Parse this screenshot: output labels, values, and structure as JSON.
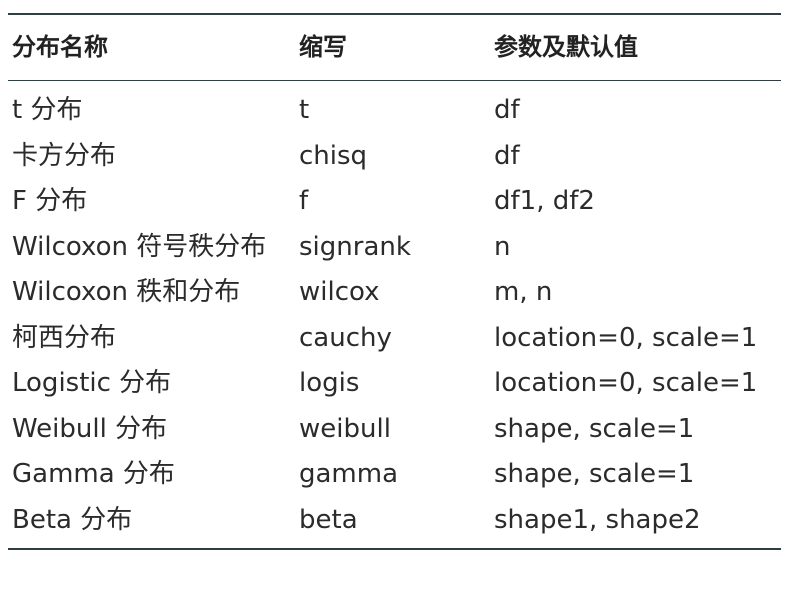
{
  "table": {
    "headers": [
      "分布名称",
      "缩写",
      "参数及默认值"
    ],
    "rows": [
      [
        "t 分布",
        "t",
        "df"
      ],
      [
        "卡方分布",
        "chisq",
        "df"
      ],
      [
        "F 分布",
        "f",
        "df1, df2"
      ],
      [
        "Wilcoxon 符号秩分布",
        "signrank",
        "n"
      ],
      [
        "Wilcoxon 秩和分布",
        "wilcox",
        "m, n"
      ],
      [
        "柯西分布",
        "cauchy",
        "location=0, scale=1"
      ],
      [
        "Logistic 分布",
        "logis",
        "location=0, scale=1"
      ],
      [
        "Weibull 分布",
        "weibull",
        "shape, scale=1"
      ],
      [
        "Gamma 分布",
        "gamma",
        "shape, scale=1"
      ],
      [
        "Beta 分布",
        "beta",
        "shape1, shape2"
      ]
    ]
  }
}
